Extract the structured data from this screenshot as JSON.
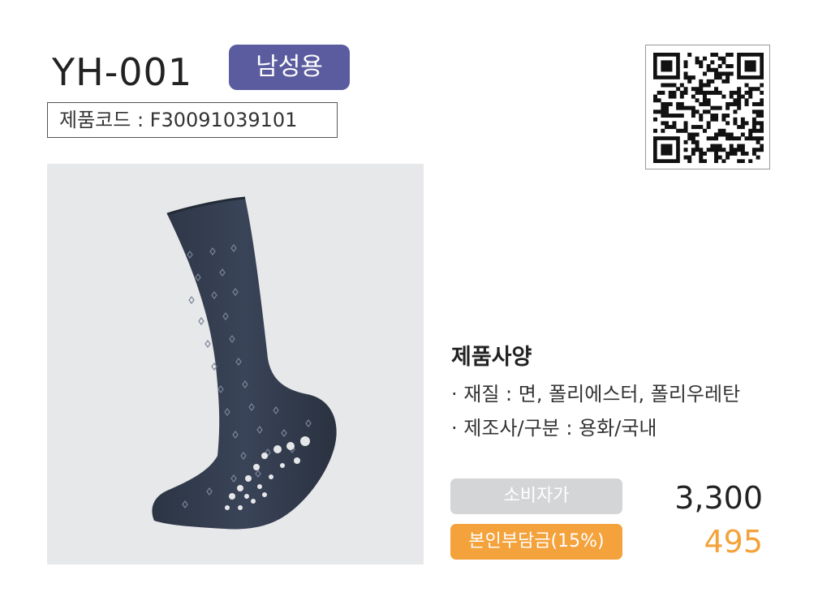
{
  "product": {
    "model": "YH-001",
    "badge": "남성용",
    "code_label": "제품코드 : F30091039101",
    "badge_color": "#5b5c9f"
  },
  "qr": {
    "icon": "qr-code-icon"
  },
  "image": {
    "icon": "sock-product-image"
  },
  "spec": {
    "title": "제품사양",
    "material": "· 재질 : 면, 폴리에스터, 폴리우레탄",
    "maker": "· 제조사/구분 : 용화/국내"
  },
  "price": {
    "consumer_label": "소비자가",
    "consumer_value": "3,300",
    "self_label": "본인부담금(15%)",
    "self_value": "495",
    "accent_color": "#f4a23b"
  }
}
